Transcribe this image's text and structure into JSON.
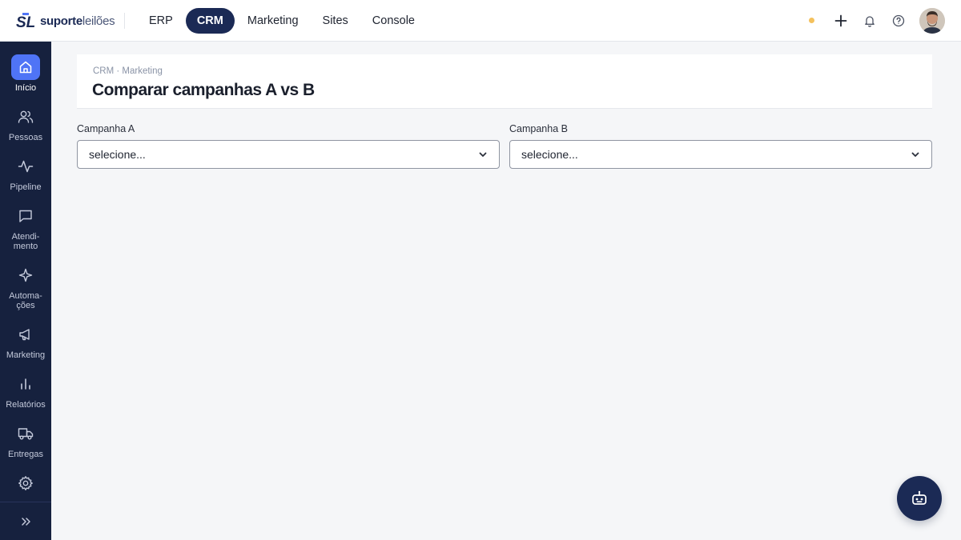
{
  "brand": {
    "name_strong": "suporte",
    "name_light": "leilões",
    "mark": "SL"
  },
  "nav": {
    "items": [
      {
        "label": "ERP",
        "active": false
      },
      {
        "label": "CRM",
        "active": true
      },
      {
        "label": "Marketing",
        "active": false
      },
      {
        "label": "Sites",
        "active": false
      },
      {
        "label": "Console",
        "active": false
      }
    ]
  },
  "topbar": {
    "status_color": "#f4c15d",
    "icons": [
      "plus-icon",
      "bell-icon",
      "help-icon",
      "avatar"
    ]
  },
  "sidebar": {
    "items": [
      {
        "label": "Início",
        "icon": "home-icon",
        "active": true
      },
      {
        "label": "Pessoas",
        "icon": "users-icon",
        "active": false
      },
      {
        "label": "Pipeline",
        "icon": "activity-icon",
        "active": false
      },
      {
        "label": "Atendi-\nmento",
        "icon": "message-icon",
        "active": false
      },
      {
        "label": "Automa-\nções",
        "icon": "sparkle-icon",
        "active": false
      },
      {
        "label": "Marketing",
        "icon": "megaphone-icon",
        "active": false
      },
      {
        "label": "Relatórios",
        "icon": "bar-chart-icon",
        "active": false
      },
      {
        "label": "Entregas",
        "icon": "truck-icon",
        "active": false
      },
      {
        "label": "",
        "icon": "gear-icon",
        "active": false
      }
    ],
    "expand_icon": "chevrons-right-icon"
  },
  "page": {
    "breadcrumb": "CRM · Marketing",
    "title": "Comparar campanhas A vs B"
  },
  "form": {
    "campaign_a": {
      "label": "Campanha A",
      "value": "selecione..."
    },
    "campaign_b": {
      "label": "Campanha B",
      "value": "selecione..."
    }
  },
  "colors": {
    "accent": "#1b2a55",
    "sidebar_bg": "#16213e",
    "active_blue": "#4f74f6"
  }
}
